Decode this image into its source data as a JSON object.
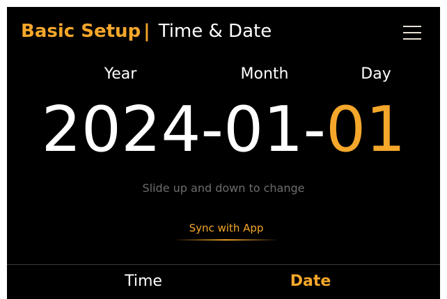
{
  "header": {
    "title": "Basic Setup",
    "separator": "|",
    "subtitle": "Time & Date",
    "menu_icon": "hamburger-menu-icon"
  },
  "columns": {
    "year_label": "Year",
    "month_label": "Month",
    "day_label": "Day"
  },
  "date": {
    "year": "2024",
    "dash1": "-",
    "month": "01",
    "dash2": "-",
    "day": "01",
    "selected_field": "day"
  },
  "hint": "Slide up and down to change",
  "sync_button_label": "Sync with App",
  "tabs": [
    {
      "label": "Time",
      "active": false
    },
    {
      "label": "Date",
      "active": true
    }
  ],
  "colors": {
    "accent": "#f5a72b",
    "background": "#000000",
    "text": "#ffffff",
    "hint": "#6d6d6d"
  }
}
